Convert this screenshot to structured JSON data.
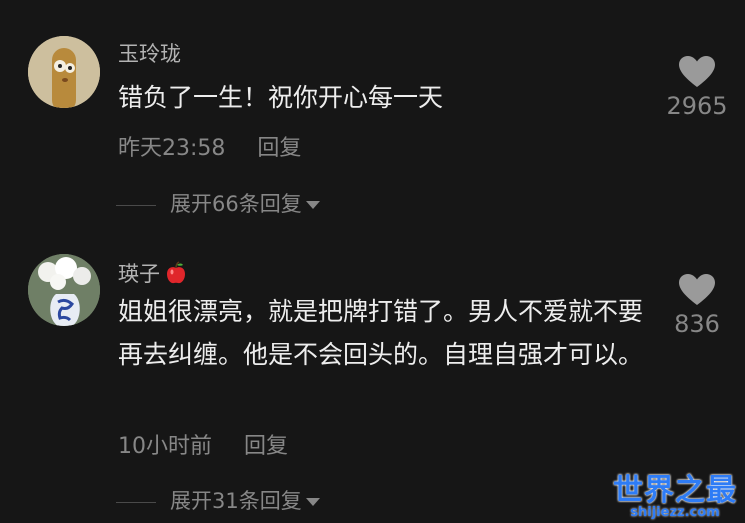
{
  "comments": [
    {
      "username": "玉玲珑",
      "avatar_icon": "cartoon-character-avatar",
      "text": "错负了一生！祝你开心每一天",
      "time": "昨天23:58",
      "reply_label": "回复",
      "likes": "2965",
      "expand_label": "展开66条回复"
    },
    {
      "username": "瑛子",
      "badge_icon": "apple-icon",
      "avatar_icon": "flower-vase-avatar",
      "text": "姐姐很漂亮，就是把牌打错了。男人不爱就不要再去纠缠。他是不会回头的。自理自强才可以。",
      "time": "10小时前",
      "reply_label": "回复",
      "likes": "836",
      "expand_label": "展开31条回复"
    }
  ],
  "watermark": {
    "main": "世界之最",
    "sub": "shijiezz.com"
  },
  "colors": {
    "background": "#161616",
    "comment_text": "#ededed",
    "secondary_text": "#878787",
    "heart": "#9a9a9a",
    "watermark": "#2e7cf6"
  }
}
